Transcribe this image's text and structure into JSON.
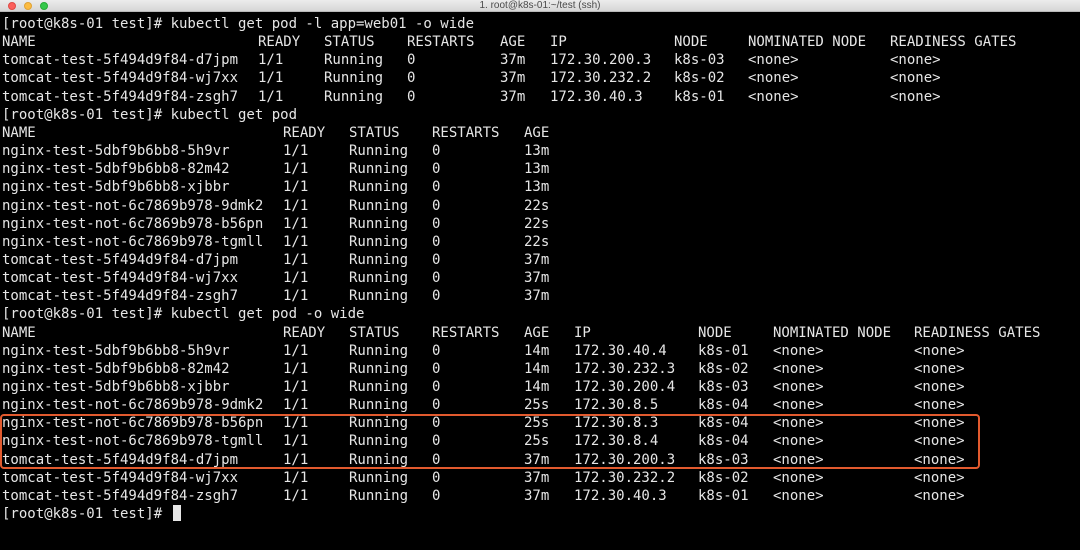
{
  "window": {
    "title": "1. root@k8s-01:~/test (ssh)"
  },
  "highlight_color": "#e25a2e",
  "terminal": {
    "blocks": [
      {
        "prompt": "[root@k8s-01 test]# kubectl get pod -l app=web01 -o wide",
        "headers": [
          "NAME",
          "READY",
          "STATUS",
          "RESTARTS",
          "AGE",
          "IP",
          "NODE",
          "NOMINATED NODE",
          "READINESS GATES"
        ],
        "rows": [
          [
            "tomcat-test-5f494d9f84-d7jpm",
            "1/1",
            "Running",
            "0",
            "37m",
            "172.30.200.3",
            "k8s-03",
            "<none>",
            "<none>"
          ],
          [
            "tomcat-test-5f494d9f84-wj7xx",
            "1/1",
            "Running",
            "0",
            "37m",
            "172.30.232.2",
            "k8s-02",
            "<none>",
            "<none>"
          ],
          [
            "tomcat-test-5f494d9f84-zsgh7",
            "1/1",
            "Running",
            "0",
            "37m",
            "172.30.40.3",
            "k8s-01",
            "<none>",
            "<none>"
          ]
        ]
      },
      {
        "prompt": "[root@k8s-01 test]# kubectl get pod",
        "headers": [
          "NAME",
          "READY",
          "STATUS",
          "RESTARTS",
          "AGE"
        ],
        "rows": [
          [
            "nginx-test-5dbf9b6bb8-5h9vr",
            "1/1",
            "Running",
            "0",
            "13m"
          ],
          [
            "nginx-test-5dbf9b6bb8-82m42",
            "1/1",
            "Running",
            "0",
            "13m"
          ],
          [
            "nginx-test-5dbf9b6bb8-xjbbr",
            "1/1",
            "Running",
            "0",
            "13m"
          ],
          [
            "nginx-test-not-6c7869b978-9dmk2",
            "1/1",
            "Running",
            "0",
            "22s"
          ],
          [
            "nginx-test-not-6c7869b978-b56pn",
            "1/1",
            "Running",
            "0",
            "22s"
          ],
          [
            "nginx-test-not-6c7869b978-tgmll",
            "1/1",
            "Running",
            "0",
            "22s"
          ],
          [
            "tomcat-test-5f494d9f84-d7jpm",
            "1/1",
            "Running",
            "0",
            "37m"
          ],
          [
            "tomcat-test-5f494d9f84-wj7xx",
            "1/1",
            "Running",
            "0",
            "37m"
          ],
          [
            "tomcat-test-5f494d9f84-zsgh7",
            "1/1",
            "Running",
            "0",
            "37m"
          ]
        ]
      },
      {
        "prompt": "[root@k8s-01 test]# kubectl get pod -o wide",
        "headers": [
          "NAME",
          "READY",
          "STATUS",
          "RESTARTS",
          "AGE",
          "IP",
          "NODE",
          "NOMINATED NODE",
          "READINESS GATES"
        ],
        "rows": [
          [
            "nginx-test-5dbf9b6bb8-5h9vr",
            "1/1",
            "Running",
            "0",
            "14m",
            "172.30.40.4",
            "k8s-01",
            "<none>",
            "<none>"
          ],
          [
            "nginx-test-5dbf9b6bb8-82m42",
            "1/1",
            "Running",
            "0",
            "14m",
            "172.30.232.3",
            "k8s-02",
            "<none>",
            "<none>"
          ],
          [
            "nginx-test-5dbf9b6bb8-xjbbr",
            "1/1",
            "Running",
            "0",
            "14m",
            "172.30.200.4",
            "k8s-03",
            "<none>",
            "<none>"
          ],
          [
            "nginx-test-not-6c7869b978-9dmk2",
            "1/1",
            "Running",
            "0",
            "25s",
            "172.30.8.5",
            "k8s-04",
            "<none>",
            "<none>"
          ],
          [
            "nginx-test-not-6c7869b978-b56pn",
            "1/1",
            "Running",
            "0",
            "25s",
            "172.30.8.3",
            "k8s-04",
            "<none>",
            "<none>"
          ],
          [
            "nginx-test-not-6c7869b978-tgmll",
            "1/1",
            "Running",
            "0",
            "25s",
            "172.30.8.4",
            "k8s-04",
            "<none>",
            "<none>"
          ],
          [
            "tomcat-test-5f494d9f84-d7jpm",
            "1/1",
            "Running",
            "0",
            "37m",
            "172.30.200.3",
            "k8s-03",
            "<none>",
            "<none>"
          ],
          [
            "tomcat-test-5f494d9f84-wj7xx",
            "1/1",
            "Running",
            "0",
            "37m",
            "172.30.232.2",
            "k8s-02",
            "<none>",
            "<none>"
          ],
          [
            "tomcat-test-5f494d9f84-zsgh7",
            "1/1",
            "Running",
            "0",
            "37m",
            "172.30.40.3",
            "k8s-01",
            "<none>",
            "<none>"
          ]
        ]
      }
    ],
    "final_prompt": "[root@k8s-01 test]#"
  }
}
